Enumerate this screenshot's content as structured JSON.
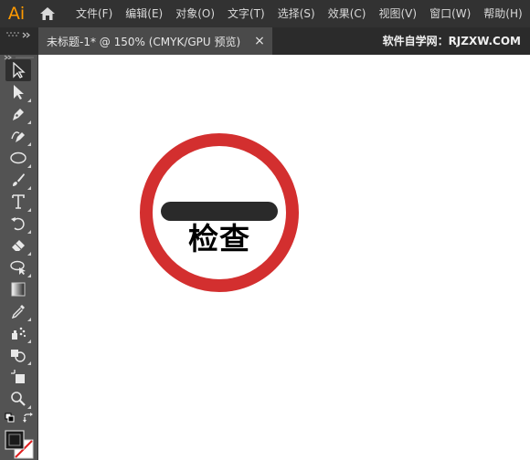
{
  "app": {
    "logo": "Ai",
    "home_icon": "home-icon"
  },
  "menu": {
    "items": [
      {
        "label": "文件(F)"
      },
      {
        "label": "编辑(E)"
      },
      {
        "label": "对象(O)"
      },
      {
        "label": "文字(T)"
      },
      {
        "label": "选择(S)"
      },
      {
        "label": "效果(C)"
      },
      {
        "label": "视图(V)"
      },
      {
        "label": "窗口(W)"
      },
      {
        "label": "帮助(H)"
      }
    ]
  },
  "document": {
    "tab_title": "未标题-1* @ 150% (CMYK/GPU 预览)",
    "close_glyph": "×",
    "watermark": "软件自学网：RJZXW.COM"
  },
  "toolbar": {
    "tools": [
      "selection-tool-icon",
      "direct-selection-tool-icon",
      "pen-tool-icon",
      "curvature-tool-icon",
      "ellipse-tool-icon",
      "paintbrush-tool-icon",
      "type-tool-icon",
      "rotate-tool-icon",
      "eraser-tool-icon",
      "lasso-tool-icon",
      "gradient-tool-icon",
      "eyedropper-tool-icon",
      "symbol-sprayer-tool-icon",
      "shape-builder-tool-icon",
      "artboard-tool-icon",
      "zoom-tool-icon"
    ],
    "fill_stroke": "fill-stroke-swatch",
    "swap_icon": "swap-fill-stroke-icon",
    "default_icon": "default-colors-icon"
  },
  "artwork": {
    "sign_text": "检查",
    "ring_color": "#d32f2f",
    "bar_color": "#2a2a2a",
    "accent_color": "#ff9a00"
  }
}
